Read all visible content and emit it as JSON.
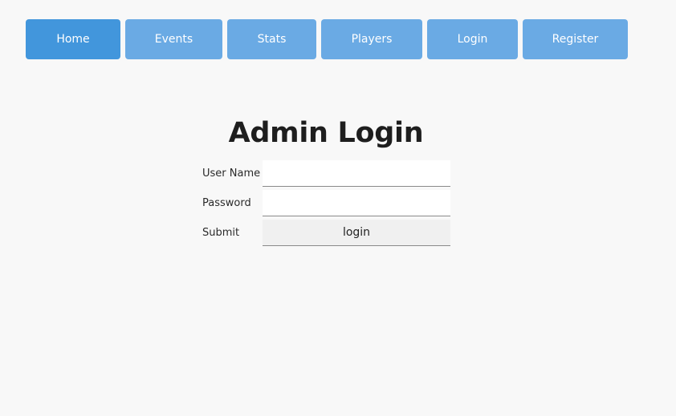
{
  "nav": {
    "items": [
      {
        "label": "Home",
        "active": true
      },
      {
        "label": "Events",
        "active": false
      },
      {
        "label": "Stats",
        "active": false
      },
      {
        "label": "Players",
        "active": false
      },
      {
        "label": "Login",
        "active": false
      },
      {
        "label": "Register",
        "active": false
      }
    ]
  },
  "page": {
    "title": "Admin Login"
  },
  "form": {
    "username_label": "User Name",
    "username_value": "",
    "password_label": "Password",
    "password_value": "",
    "submit_label": "Submit",
    "submit_button": "login"
  },
  "colors": {
    "nav_active": "#4296dc",
    "nav_default": "#6aaae4",
    "background": "#f8f8f8"
  }
}
